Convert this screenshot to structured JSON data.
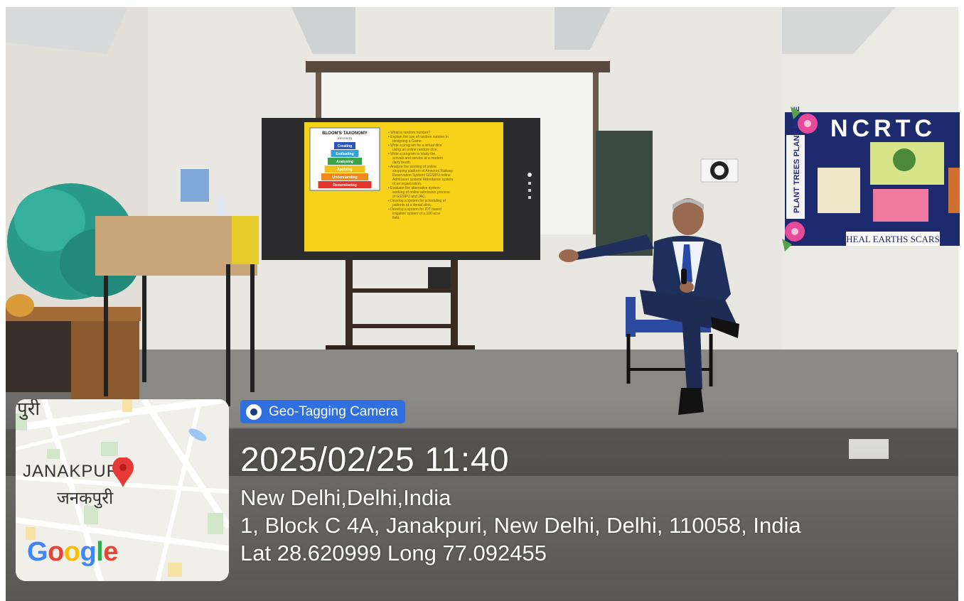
{
  "slide": {
    "title": "BLOOM'S TAXONOMY",
    "subtitle": "(REVISED)",
    "levels": [
      "Creating",
      "Evaluating",
      "Analysing",
      "Applying",
      "Understanding",
      "Remembering"
    ],
    "level_colors": [
      "#2f55b6",
      "#3aa0d8",
      "#39a447",
      "#f1c21b",
      "#f08a1c",
      "#e2362b"
    ],
    "bullets": [
      "What is random number?",
      "Explain the use of random number in designing a Game.",
      "Write a program for a virtual dice using an online random dice.",
      "Write a program to study the arrivals and service at a modern dairy booth.",
      "Analyze the working of online shopping platform of Amazon/ Railway Reservation System/ GGSIPU online Admission system/ Attendance system of an organization.",
      "Evaluate the alternative system- working of online admission process of GGSIPU and JAC.",
      "Develop a system for scheduling of patients at a dental clinic.",
      "Develop a system for IOT based irrigation system of a 100 acre field."
    ]
  },
  "poster": {
    "title": "NCRTC",
    "vertical_text": "PLANT TREES PLANT HOPE",
    "banner": "HEAL EARTHS SCARS"
  },
  "map": {
    "top_label": "पुरी",
    "label_en": "JANAKPURI",
    "label_hi": "जनकपुरी",
    "logo": "Google"
  },
  "geotag": {
    "app_name": "Geo-Tagging Camera",
    "datetime": "2025/02/25 11:40",
    "city": "New Delhi,Delhi,India",
    "address": "1, Block C 4A, Janakpuri, New Delhi, Delhi, 110058, India",
    "coords": "Lat 28.620999 Long 77.092455"
  },
  "colors": {
    "slide_bg": "#f7d21a",
    "poster_board": "#1e2a6e",
    "badge": "#2f6fe0",
    "suit": "#1f2f5c"
  }
}
